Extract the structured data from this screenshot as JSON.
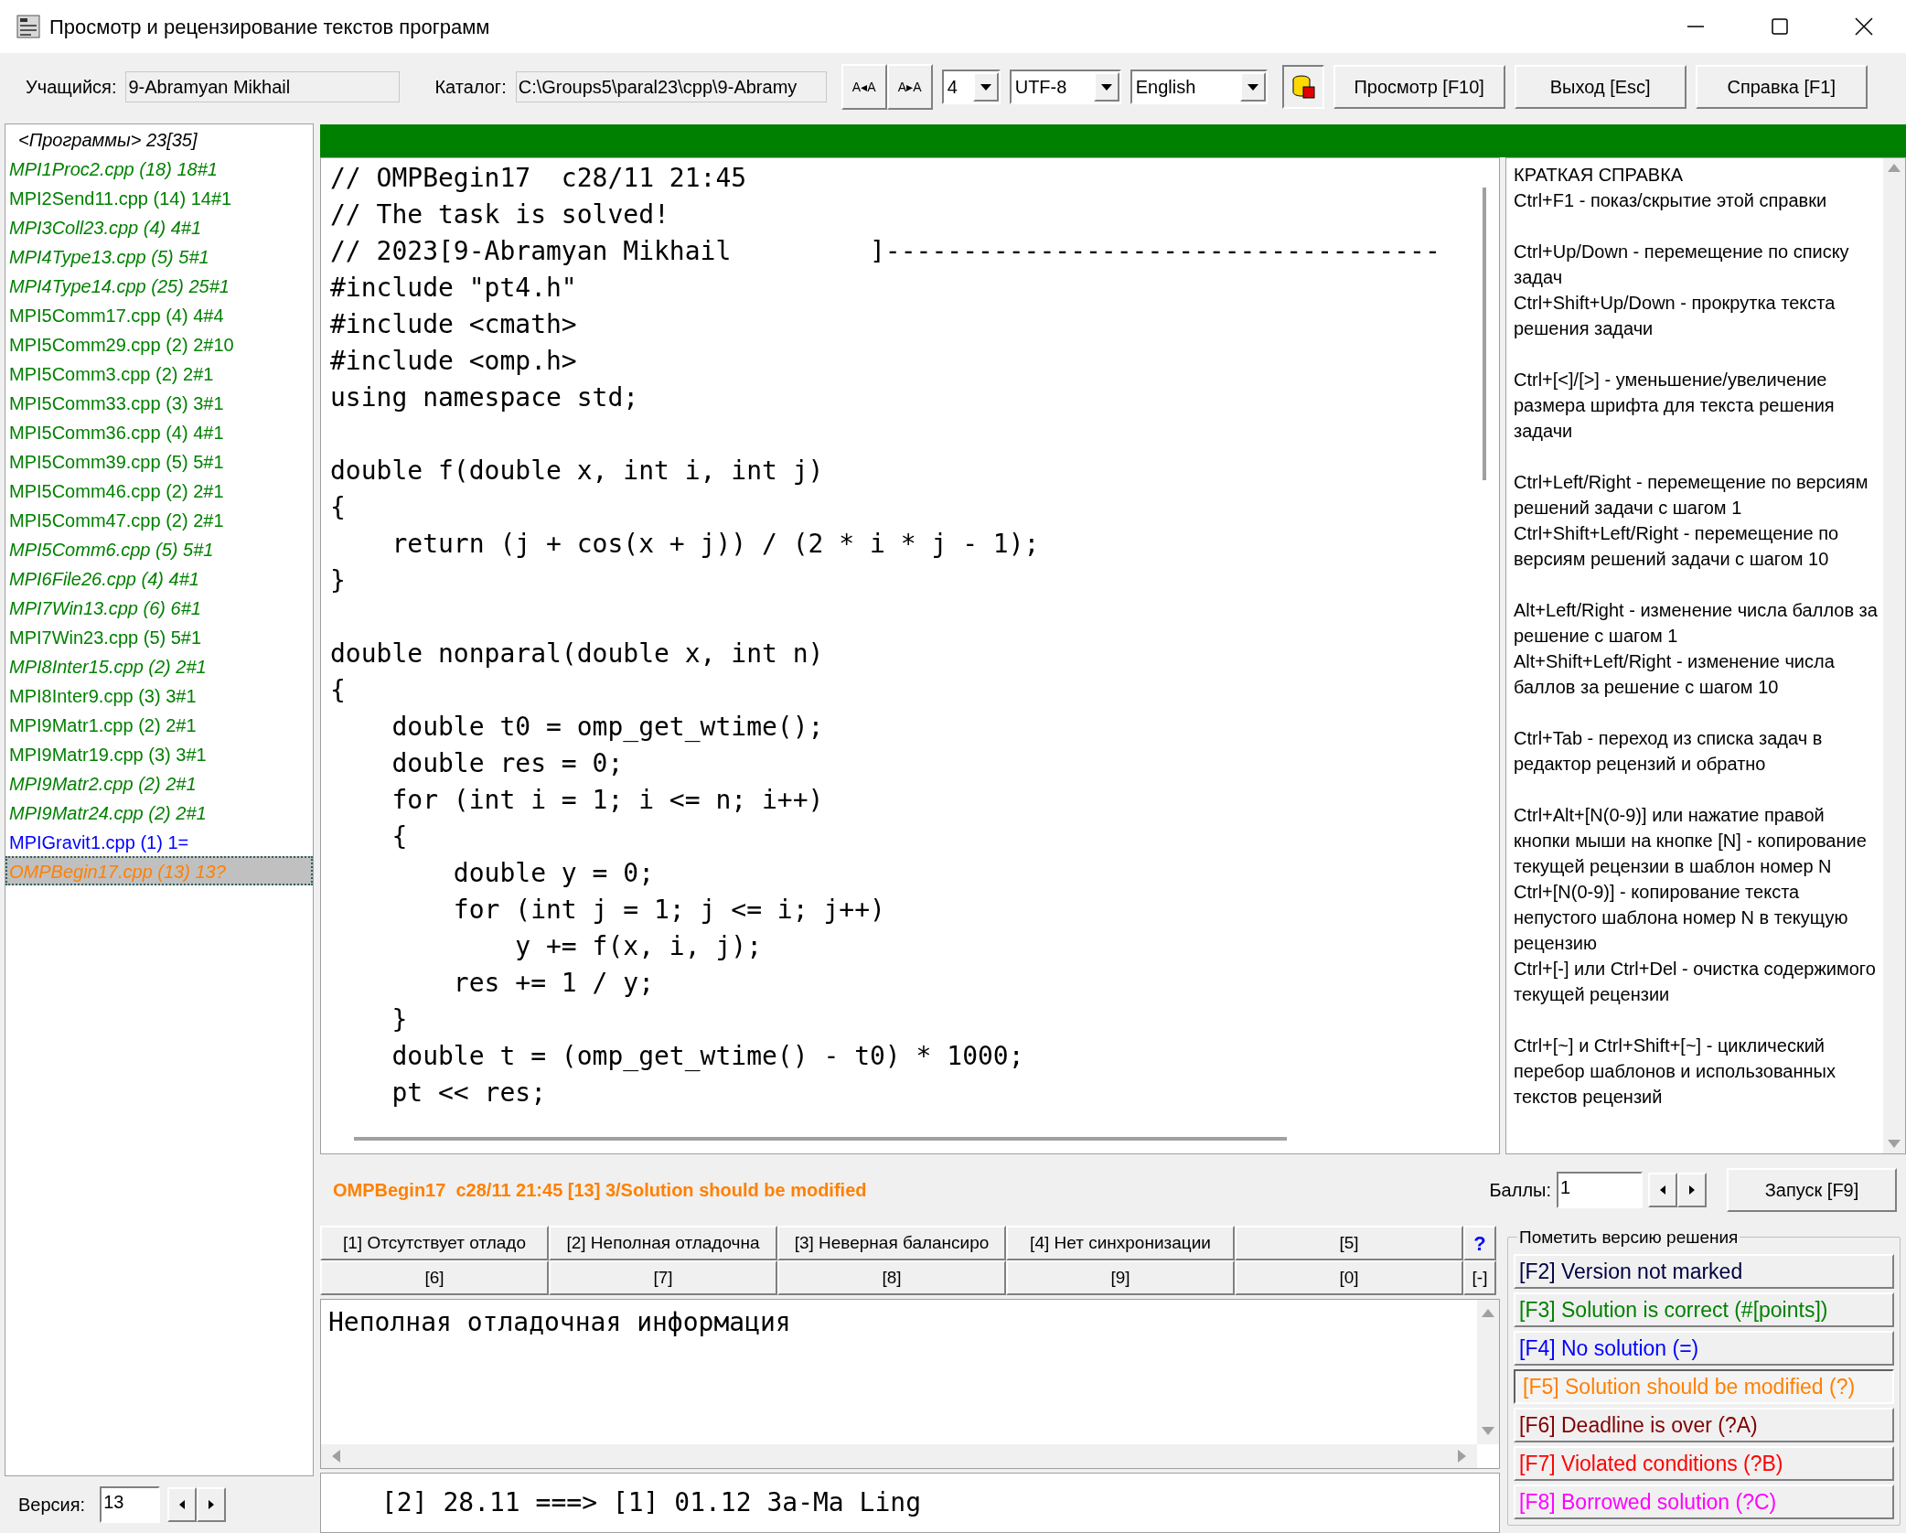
{
  "window": {
    "title": "Просмотр и рецензирование текстов программ"
  },
  "toolbar": {
    "student_label": "Учащийся:",
    "student": "9-Abramyan Mikhail",
    "catalog_label": "Каталог:",
    "catalog": "C:\\Groups5\\paral23\\cpp\\9-Abramy",
    "font_buttons": [
      "A◂A",
      "A▸A"
    ],
    "dropdowns": [
      {
        "value": "4"
      },
      {
        "value": "UTF-8"
      },
      {
        "value": "English"
      }
    ],
    "buttons": [
      "Просмотр [F10]",
      "Выход [Esc]",
      "Справка [F1]"
    ]
  },
  "programs": {
    "header": "<Программы> 23[35]",
    "items": [
      {
        "label": "MPI1Proc2.cpp (18) 18#1",
        "italic": true,
        "color": "#008000",
        "selected": false
      },
      {
        "label": "MPI2Send11.cpp (14) 14#1",
        "italic": false,
        "color": "#008000",
        "selected": false
      },
      {
        "label": "MPI3Coll23.cpp (4) 4#1",
        "italic": true,
        "color": "#008000",
        "selected": false
      },
      {
        "label": "MPI4Type13.cpp (5) 5#1",
        "italic": true,
        "color": "#008000",
        "selected": false
      },
      {
        "label": "MPI4Type14.cpp (25) 25#1",
        "italic": true,
        "color": "#008000",
        "selected": false
      },
      {
        "label": "MPI5Comm17.cpp (4) 4#4",
        "italic": false,
        "color": "#008000",
        "selected": false
      },
      {
        "label": "MPI5Comm29.cpp (2) 2#10",
        "italic": false,
        "color": "#008000",
        "selected": false
      },
      {
        "label": "MPI5Comm3.cpp (2) 2#1",
        "italic": false,
        "color": "#008000",
        "selected": false
      },
      {
        "label": "MPI5Comm33.cpp (3) 3#1",
        "italic": false,
        "color": "#008000",
        "selected": false
      },
      {
        "label": "MPI5Comm36.cpp (4) 4#1",
        "italic": false,
        "color": "#008000",
        "selected": false
      },
      {
        "label": "MPI5Comm39.cpp (5) 5#1",
        "italic": false,
        "color": "#008000",
        "selected": false
      },
      {
        "label": "MPI5Comm46.cpp (2) 2#1",
        "italic": false,
        "color": "#008000",
        "selected": false
      },
      {
        "label": "MPI5Comm47.cpp (2) 2#1",
        "italic": false,
        "color": "#008000",
        "selected": false
      },
      {
        "label": "MPI5Comm6.cpp (5) 5#1",
        "italic": true,
        "color": "#008000",
        "selected": false
      },
      {
        "label": "MPI6File26.cpp (4) 4#1",
        "italic": true,
        "color": "#008000",
        "selected": false
      },
      {
        "label": "MPI7Win13.cpp (6) 6#1",
        "italic": true,
        "color": "#008000",
        "selected": false
      },
      {
        "label": "MPI7Win23.cpp (5) 5#1",
        "italic": false,
        "color": "#008000",
        "selected": false
      },
      {
        "label": "MPI8Inter15.cpp (2) 2#1",
        "italic": true,
        "color": "#008000",
        "selected": false
      },
      {
        "label": "MPI8Inter9.cpp (3) 3#1",
        "italic": false,
        "color": "#008000",
        "selected": false
      },
      {
        "label": "MPI9Matr1.cpp (2) 2#1",
        "italic": false,
        "color": "#008000",
        "selected": false
      },
      {
        "label": "MPI9Matr19.cpp (3) 3#1",
        "italic": false,
        "color": "#008000",
        "selected": false
      },
      {
        "label": "MPI9Matr2.cpp (2) 2#1",
        "italic": true,
        "color": "#008000",
        "selected": false
      },
      {
        "label": "MPI9Matr24.cpp (2) 2#1",
        "italic": true,
        "color": "#008000",
        "selected": false
      },
      {
        "label": "MPIGravit1.cpp (1) 1=",
        "italic": false,
        "color": "#0000ff",
        "selected": false
      },
      {
        "label": "OMPBegin17.cpp (13) 13?",
        "italic": true,
        "color": "#ff8000",
        "selected": true
      }
    ]
  },
  "version": {
    "label": "Версия:",
    "value": "13"
  },
  "progress": {
    "level": 1
  },
  "code": {
    "blocks": [
      [
        "// OMPBegin17  c28/11 21:45",
        "// The task is solved!",
        "// 2023[9-Abramyan Mikhail         ]------------------------------------",
        "#include \"pt4.h\"",
        "#include <cmath>",
        "#include <omp.h>",
        "using namespace std;"
      ],
      [
        "double f(double x, int i, int j)",
        "{",
        "    return (j + cos(x + j)) / (2 * i * j - 1);",
        "}"
      ],
      [
        "double nonparal(double x, int n)",
        "{",
        "    double t0 = omp_get_wtime();",
        "    double res = 0;",
        "    for (int i = 1; i <= n; i++)",
        "    {",
        "        double y = 0;",
        "        for (int j = 1; j <= i; j++)",
        "            y += f(x, i, j);",
        "        res += 1 / y;",
        "    }",
        "    double t = (omp_get_wtime() - t0) * 1000;",
        "    pt << res;"
      ]
    ]
  },
  "help": {
    "title": "КРАТКАЯ СПРАВКА",
    "groups": [
      [
        "Ctrl+F1 - показ/скрытие этой справки"
      ],
      [
        "Ctrl+Up/Down - перемещение по списку задач",
        "Ctrl+Shift+Up/Down - прокрутка текста решения задачи"
      ],
      [
        "Ctrl+[<]/[>] - уменьшение/увеличение размера шрифта для текста решения задачи"
      ],
      [
        "Ctrl+Left/Right - перемещение по версиям решений задачи с шагом 1",
        "Ctrl+Shift+Left/Right - перемещение по версиям решений задачи с шагом 10"
      ],
      [
        "Alt+Left/Right - изменение числа баллов за решение с шагом 1",
        "Alt+Shift+Left/Right - изменение числа баллов за решение с шагом 10"
      ],
      [
        "Ctrl+Tab - переход из списка задач в редактор рецензий и обратно"
      ],
      [
        "Ctrl+Alt+[N(0-9)] или нажатие правой кнопки мыши на кнопке [N] - копирование текущей рецензии в шаблон номер N",
        "Ctrl+[N(0-9)] - копирование текста непустого шаблона номер N в текущую рецензию",
        "Ctrl+[-] или Ctrl+Del - очистка содержимого текущей рецензии"
      ],
      [
        "Ctrl+[~] и Ctrl+Shift+[~] - циклический перебор шаблонов и использованных текстов рецензий"
      ]
    ]
  },
  "status": {
    "text": "OMPBegin17  c28/11 21:45 [13] 3/Solution should be modified",
    "points_label": "Баллы:",
    "points": "1",
    "run_button": "Запуск [F9]"
  },
  "templates": {
    "row_1": [
      "[1] Отсутствует отладо",
      "[2] Неполная отладочна",
      "[3] Неверная балансиро",
      "[4] Нет синхронизации",
      "[5]"
    ],
    "help_button": "?",
    "row_2": [
      "[6]",
      "[7]",
      "[8]",
      "[9]",
      "[0]"
    ],
    "clear_button": "[-]"
  },
  "review": {
    "text": "Неполная отладочная информация"
  },
  "history": "[2] 28.11 ===> [1] 01.12 За-Ма Ling",
  "marks": {
    "title": "Пометить версию решения",
    "buttons": [
      {
        "label": "[F2] Version not marked",
        "color": "#000040",
        "selected": false
      },
      {
        "label": "[F3] Solution is correct (#[points])",
        "color": "#008000",
        "selected": false
      },
      {
        "label": "[F4] No solution (=)",
        "color": "#0000ff",
        "selected": false
      },
      {
        "label": "[F5] Solution should be modified (?)",
        "color": "#ff8000",
        "selected": true
      },
      {
        "label": "[F6] Deadline is over (?A)",
        "color": "#800000",
        "selected": false
      },
      {
        "label": "[F7] Violated conditions (?B)",
        "color": "#ff0000",
        "selected": false
      },
      {
        "label": "[F8] Borrowed solution (?C)",
        "color": "#ff00ff",
        "selected": false
      }
    ]
  }
}
